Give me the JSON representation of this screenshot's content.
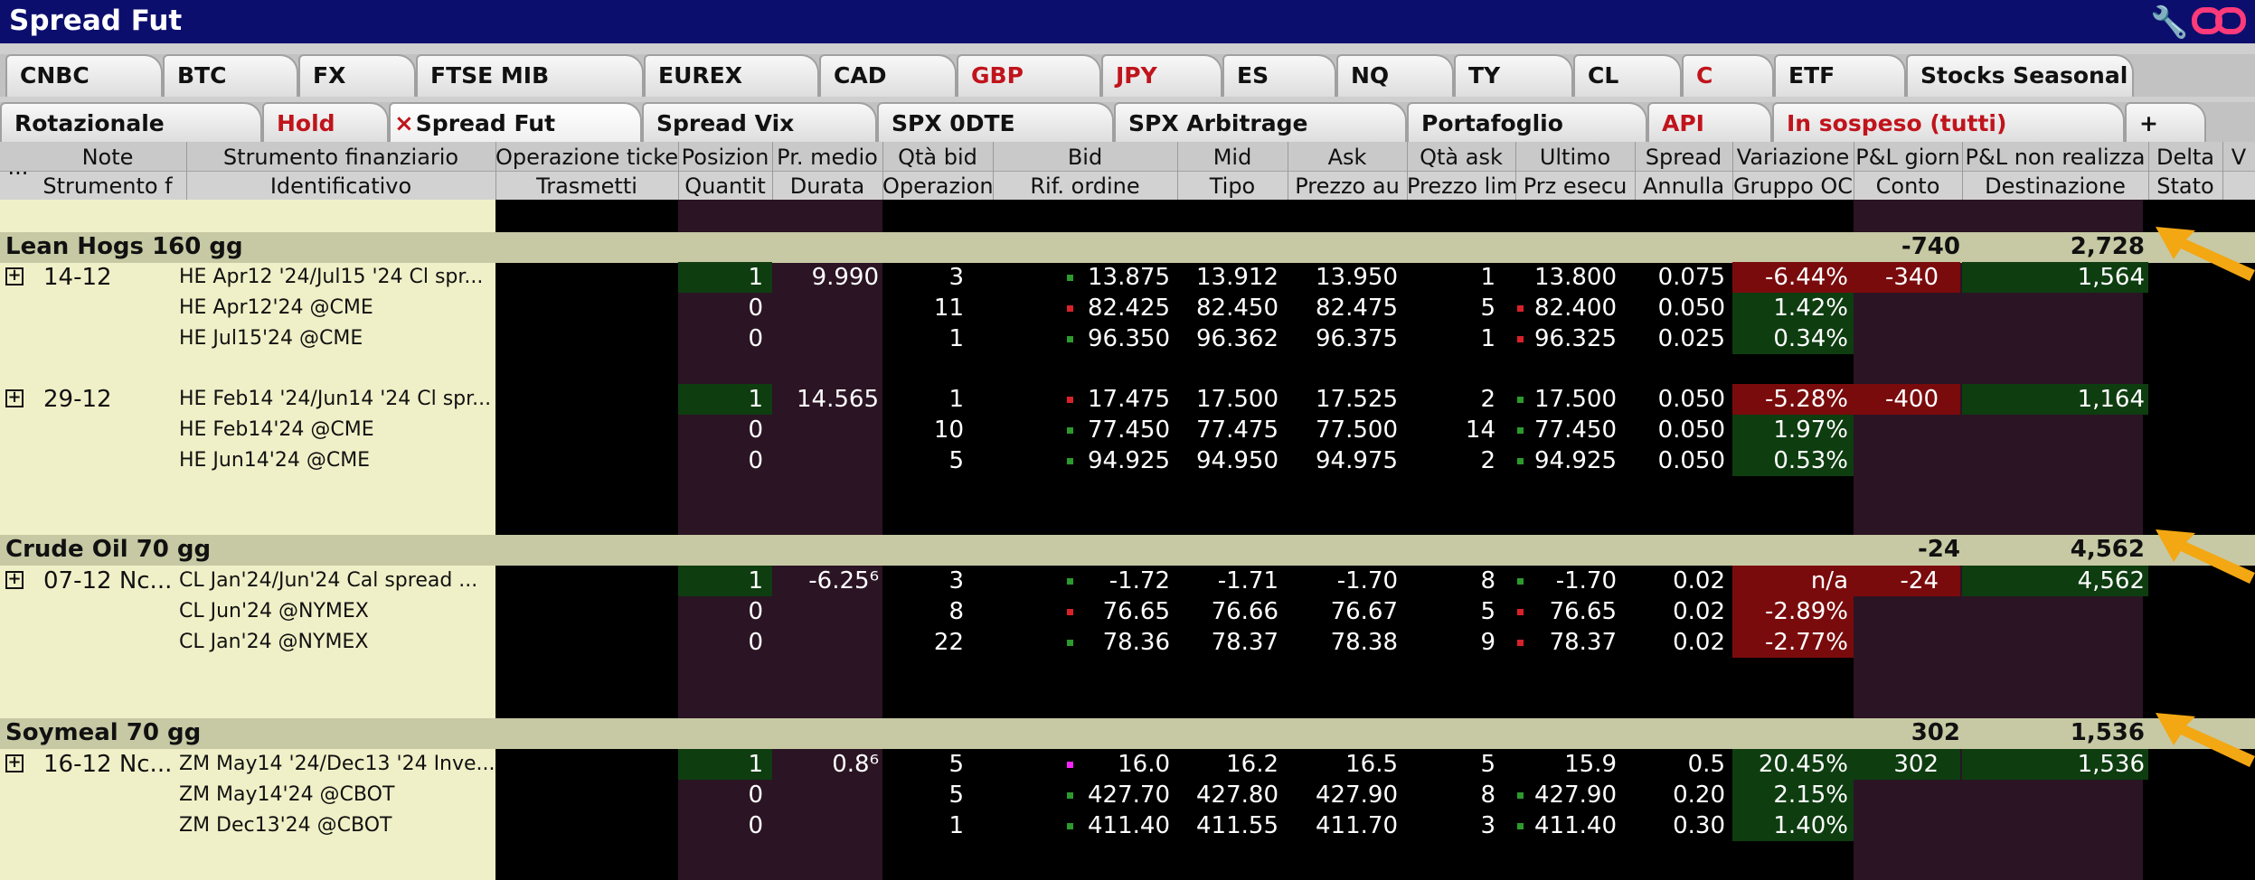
{
  "window": {
    "title": "Spread Fut"
  },
  "tabs_row1": [
    {
      "label": "CNBC",
      "red": false
    },
    {
      "label": "BTC",
      "red": false
    },
    {
      "label": "FX",
      "red": false
    },
    {
      "label": "FTSE MIB",
      "red": false
    },
    {
      "label": "EUREX",
      "red": false
    },
    {
      "label": "CAD",
      "red": false
    },
    {
      "label": "GBP",
      "red": true
    },
    {
      "label": "JPY",
      "red": true
    },
    {
      "label": "ES",
      "red": false
    },
    {
      "label": "NQ",
      "red": false
    },
    {
      "label": "TY",
      "red": false
    },
    {
      "label": "CL",
      "red": false
    },
    {
      "label": "C",
      "red": true
    },
    {
      "label": "ETF",
      "red": false
    },
    {
      "label": "Stocks Seasonal",
      "red": false
    }
  ],
  "tabs_row2": [
    {
      "label": "Rotazionale",
      "red": false
    },
    {
      "label": "Hold",
      "red": true
    },
    {
      "label": "Spread Fut",
      "red": false,
      "active": true
    },
    {
      "label": "Spread Vix",
      "red": false
    },
    {
      "label": "SPX 0DTE",
      "red": false
    },
    {
      "label": "SPX Arbitrage",
      "red": false
    },
    {
      "label": "Portafoglio",
      "red": false
    },
    {
      "label": "API",
      "red": true
    },
    {
      "label": "In sospeso (tutti)",
      "red": true
    },
    {
      "label": "+",
      "red": false
    }
  ],
  "headers": {
    "ellipsis": "...",
    "row1": [
      "Note",
      "Strumento finanziario",
      "Operazione ticke",
      "Posizion",
      "Pr. medio",
      "Qtà bid",
      "Bid",
      "Mid",
      "Ask",
      "Qtà ask",
      "Ultimo",
      "Spread",
      "Variazione",
      "P&L giorn",
      "P&L non realizza",
      "Delta",
      "V"
    ],
    "row2": [
      "Strumento f",
      "Identificativo",
      "Trasmetti",
      "Quantit",
      "Durata",
      "Operazion",
      "Rif. ordine",
      "Tipo",
      "Prezzo au",
      "Prezzo lim",
      "Prz esecu",
      "Annulla",
      "Gruppo OC",
      "Conto",
      "Destinazione",
      "Stato",
      ""
    ]
  },
  "groups": [
    {
      "name": "Lean Hogs 160 gg",
      "pnl_day": "-740",
      "pnl_unreal": "2,728",
      "spreads": [
        {
          "note": "14-12",
          "legs": [
            {
              "instrument": "HE Apr12 '24/Jul15 '24 Cl spr...",
              "pos": "1",
              "avg": "9.990",
              "bidqty": "3",
              "bid": "13.875",
              "mid": "13.912",
              "ask": "13.950",
              "askqty": "1",
              "last": "13.800",
              "spread": "0.075",
              "chg": "-6.44%",
              "chgneg": true,
              "pnlday": "-340",
              "pnlunreal": "1,564",
              "bidcol": "green",
              "lastcol": ""
            },
            {
              "instrument": "HE Apr12'24 @CME",
              "pos": "0",
              "avg": "",
              "bidqty": "11",
              "bid": "82.425",
              "mid": "82.450",
              "ask": "82.475",
              "askqty": "5",
              "last": "82.400",
              "spread": "0.050",
              "chg": "1.42%",
              "chgneg": false,
              "pnlday": "",
              "pnlunreal": "",
              "bidcol": "red",
              "lastcol": "red"
            },
            {
              "instrument": "HE Jul15'24 @CME",
              "pos": "0",
              "avg": "",
              "bidqty": "1",
              "bid": "96.350",
              "mid": "96.362",
              "ask": "96.375",
              "askqty": "1",
              "last": "96.325",
              "spread": "0.025",
              "chg": "0.34%",
              "chgneg": false,
              "pnlday": "",
              "pnlunreal": "",
              "bidcol": "green",
              "lastcol": "red"
            }
          ]
        },
        {
          "note": "29-12",
          "legs": [
            {
              "instrument": "HE Feb14 '24/Jun14 '24 Cl spr...",
              "pos": "1",
              "avg": "14.565",
              "bidqty": "1",
              "bid": "17.475",
              "mid": "17.500",
              "ask": "17.525",
              "askqty": "2",
              "last": "17.500",
              "spread": "0.050",
              "chg": "-5.28%",
              "chgneg": true,
              "pnlday": "-400",
              "pnlunreal": "1,164",
              "bidcol": "red",
              "lastcol": "green"
            },
            {
              "instrument": "HE Feb14'24 @CME",
              "pos": "0",
              "avg": "",
              "bidqty": "10",
              "bid": "77.450",
              "mid": "77.475",
              "ask": "77.500",
              "askqty": "14",
              "last": "77.450",
              "spread": "0.050",
              "chg": "1.97%",
              "chgneg": false,
              "pnlday": "",
              "pnlunreal": "",
              "bidcol": "green",
              "lastcol": "green"
            },
            {
              "instrument": "HE Jun14'24 @CME",
              "pos": "0",
              "avg": "",
              "bidqty": "5",
              "bid": "94.925",
              "mid": "94.950",
              "ask": "94.975",
              "askqty": "2",
              "last": "94.925",
              "spread": "0.050",
              "chg": "0.53%",
              "chgneg": false,
              "pnlday": "",
              "pnlunreal": "",
              "bidcol": "green",
              "lastcol": "green"
            }
          ]
        }
      ]
    },
    {
      "name": "Crude Oil 70 gg",
      "pnl_day": "-24",
      "pnl_unreal": "4,562",
      "spreads": [
        {
          "note": "07-12 Nc...",
          "legs": [
            {
              "instrument": "CL Jan'24/Jun'24 Cal spread ...",
              "pos": "1",
              "avg": "-6.25⁶",
              "bidqty": "3",
              "bid": "-1.72",
              "mid": "-1.71",
              "ask": "-1.70",
              "askqty": "8",
              "last": "-1.70",
              "spread": "0.02",
              "chg": "n/a",
              "chgneg": true,
              "pnlday": "-24",
              "pnlunreal": "4,562",
              "bidcol": "green",
              "lastcol": "green"
            },
            {
              "instrument": "CL Jun'24 @NYMEX",
              "pos": "0",
              "avg": "",
              "bidqty": "8",
              "bid": "76.65",
              "mid": "76.66",
              "ask": "76.67",
              "askqty": "5",
              "last": "76.65",
              "spread": "0.02",
              "chg": "-2.89%",
              "chgneg": true,
              "pnlday": "",
              "pnlunreal": "",
              "bidcol": "red",
              "lastcol": "red"
            },
            {
              "instrument": "CL Jan'24 @NYMEX",
              "pos": "0",
              "avg": "",
              "bidqty": "22",
              "bid": "78.36",
              "mid": "78.37",
              "ask": "78.38",
              "askqty": "9",
              "last": "78.37",
              "spread": "0.02",
              "chg": "-2.77%",
              "chgneg": true,
              "pnlday": "",
              "pnlunreal": "",
              "bidcol": "green",
              "lastcol": "red"
            }
          ]
        }
      ]
    },
    {
      "name": "Soymeal 70 gg",
      "pnl_day": "302",
      "pnl_unreal": "1,536",
      "spreads": [
        {
          "note": "16-12 Nc...",
          "legs": [
            {
              "instrument": "ZM May14 '24/Dec13 '24 Inve...",
              "pos": "1",
              "avg": "0.8⁶",
              "bidqty": "5",
              "bid": "16.0",
              "mid": "16.2",
              "ask": "16.5",
              "askqty": "5",
              "last": "15.9",
              "spread": "0.5",
              "chg": "20.45%",
              "chgneg": false,
              "pnlday": "302",
              "pnlunreal": "1,536",
              "bidcol": "magenta",
              "lastcol": ""
            },
            {
              "instrument": "ZM May14'24 @CBOT",
              "pos": "0",
              "avg": "",
              "bidqty": "5",
              "bid": "427.70",
              "mid": "427.80",
              "ask": "427.90",
              "askqty": "8",
              "last": "427.90",
              "spread": "0.20",
              "chg": "2.15%",
              "chgneg": false,
              "pnlday": "",
              "pnlunreal": "",
              "bidcol": "green",
              "lastcol": "green"
            },
            {
              "instrument": "ZM Dec13'24 @CBOT",
              "pos": "0",
              "avg": "",
              "bidqty": "1",
              "bid": "411.40",
              "mid": "411.55",
              "ask": "411.70",
              "askqty": "3",
              "last": "411.40",
              "spread": "0.30",
              "chg": "1.40%",
              "chgneg": false,
              "pnlday": "",
              "pnlunreal": "",
              "bidcol": "green",
              "lastcol": "green"
            }
          ]
        }
      ]
    }
  ],
  "icons": {
    "wrench": "wrench-icon",
    "link": "link-icon",
    "expand": "expand-plus-icon",
    "arrow": "arrow-annotation-icon"
  },
  "colors": {
    "titlebar": "#0c0e6e",
    "group": "#c7c9a4",
    "positive": "#0e3d10",
    "negative": "#7a0b0c",
    "note": "#f0f0c8",
    "accent_arrow": "#f3a712"
  }
}
